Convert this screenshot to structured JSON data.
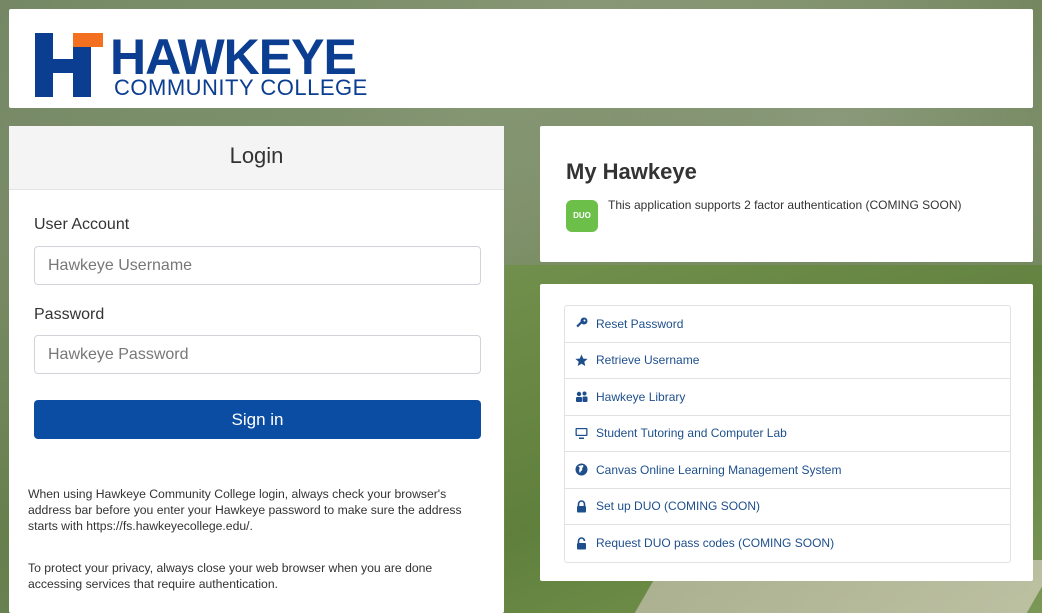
{
  "header": {
    "logo_name": "HAWKEYE",
    "logo_sub": "COMMUNITY COLLEGE"
  },
  "login": {
    "title": "Login",
    "user_label": "User Account",
    "user_placeholder": "Hawkeye Username",
    "password_label": "Password",
    "password_placeholder": "Hawkeye Password",
    "signin_label": "Sign in",
    "note1": "When using Hawkeye Community College login, always check your browser's address bar before you enter your Hawkeye password to make sure the address starts with https://fs.hawkeyecollege.edu/.",
    "note2": "To protect your privacy, always close your web browser when you are done accessing services that require authentication."
  },
  "my_hawkeye": {
    "title": "My Hawkeye",
    "duo_icon_text": "DUO",
    "duo_text": "This application supports 2 factor authentication (COMING SOON)"
  },
  "links": [
    {
      "label": "Reset Password",
      "icon": "key-icon"
    },
    {
      "label": "Retrieve Username",
      "icon": "star-icon"
    },
    {
      "label": "Hawkeye Library",
      "icon": "users-icon"
    },
    {
      "label": "Student Tutoring and Computer Lab",
      "icon": "monitor-icon"
    },
    {
      "label": "Canvas Online Learning Management System",
      "icon": "globe-icon"
    },
    {
      "label": "Set up DUO (COMING SOON)",
      "icon": "lock-icon"
    },
    {
      "label": "Request DUO pass codes (COMING SOON)",
      "icon": "unlock-icon"
    }
  ],
  "colors": {
    "brand_blue": "#0b3d91",
    "signin_blue": "#0b4da2",
    "logo_orange": "#f37021",
    "duo_green": "#6cc04a",
    "link_color": "#1e4f8c"
  }
}
